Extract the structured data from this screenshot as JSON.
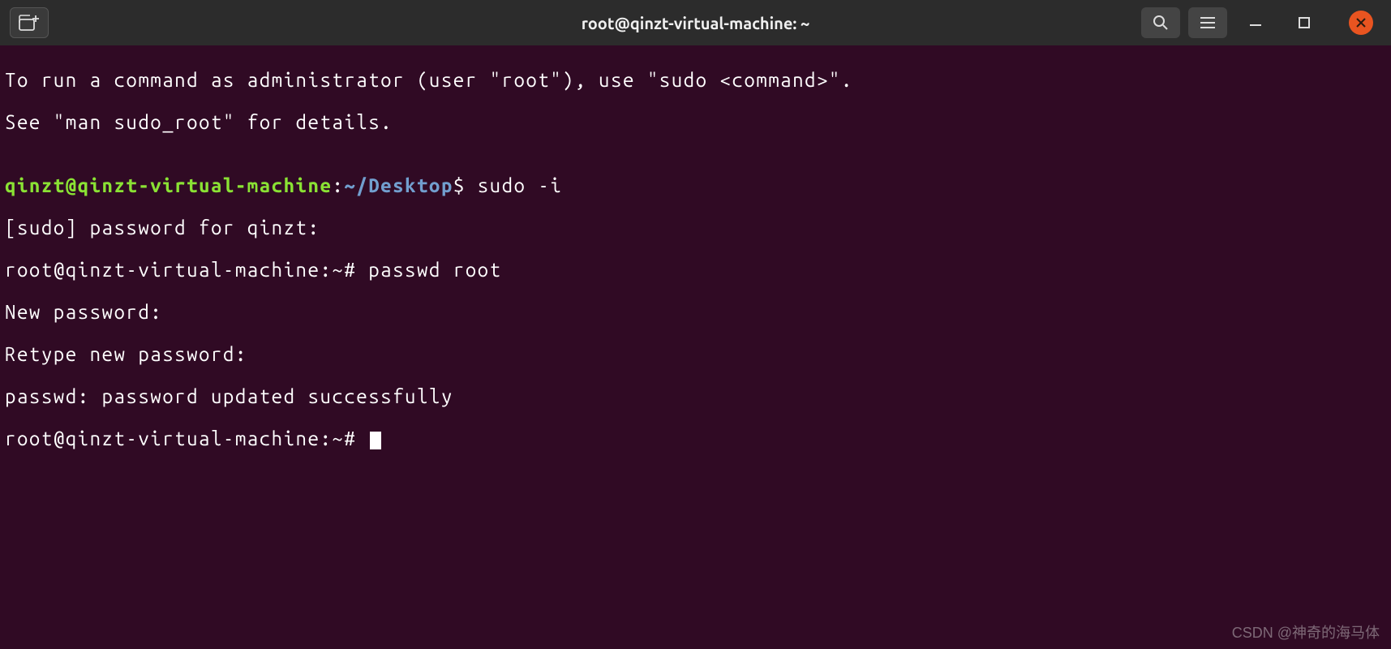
{
  "titlebar": {
    "title": "root@qinzt-virtual-machine: ~"
  },
  "terminal": {
    "motd1": "To run a command as administrator (user \"root\"), use \"sudo <command>\".",
    "motd2": "See \"man sudo_root\" for details.",
    "blank1": "",
    "prompt1_user": "qinzt@qinzt-virtual-machine",
    "prompt1_colon": ":",
    "prompt1_path": "~/Desktop",
    "prompt1_dollar": "$ ",
    "cmd1": "sudo -i",
    "line2": "[sudo] password for qinzt: ",
    "line3": "root@qinzt-virtual-machine:~# passwd root",
    "line4": "New password: ",
    "line5": "Retype new password: ",
    "line6": "passwd: password updated successfully",
    "line7": "root@qinzt-virtual-machine:~# "
  },
  "watermark": "CSDN @神奇的海马体"
}
